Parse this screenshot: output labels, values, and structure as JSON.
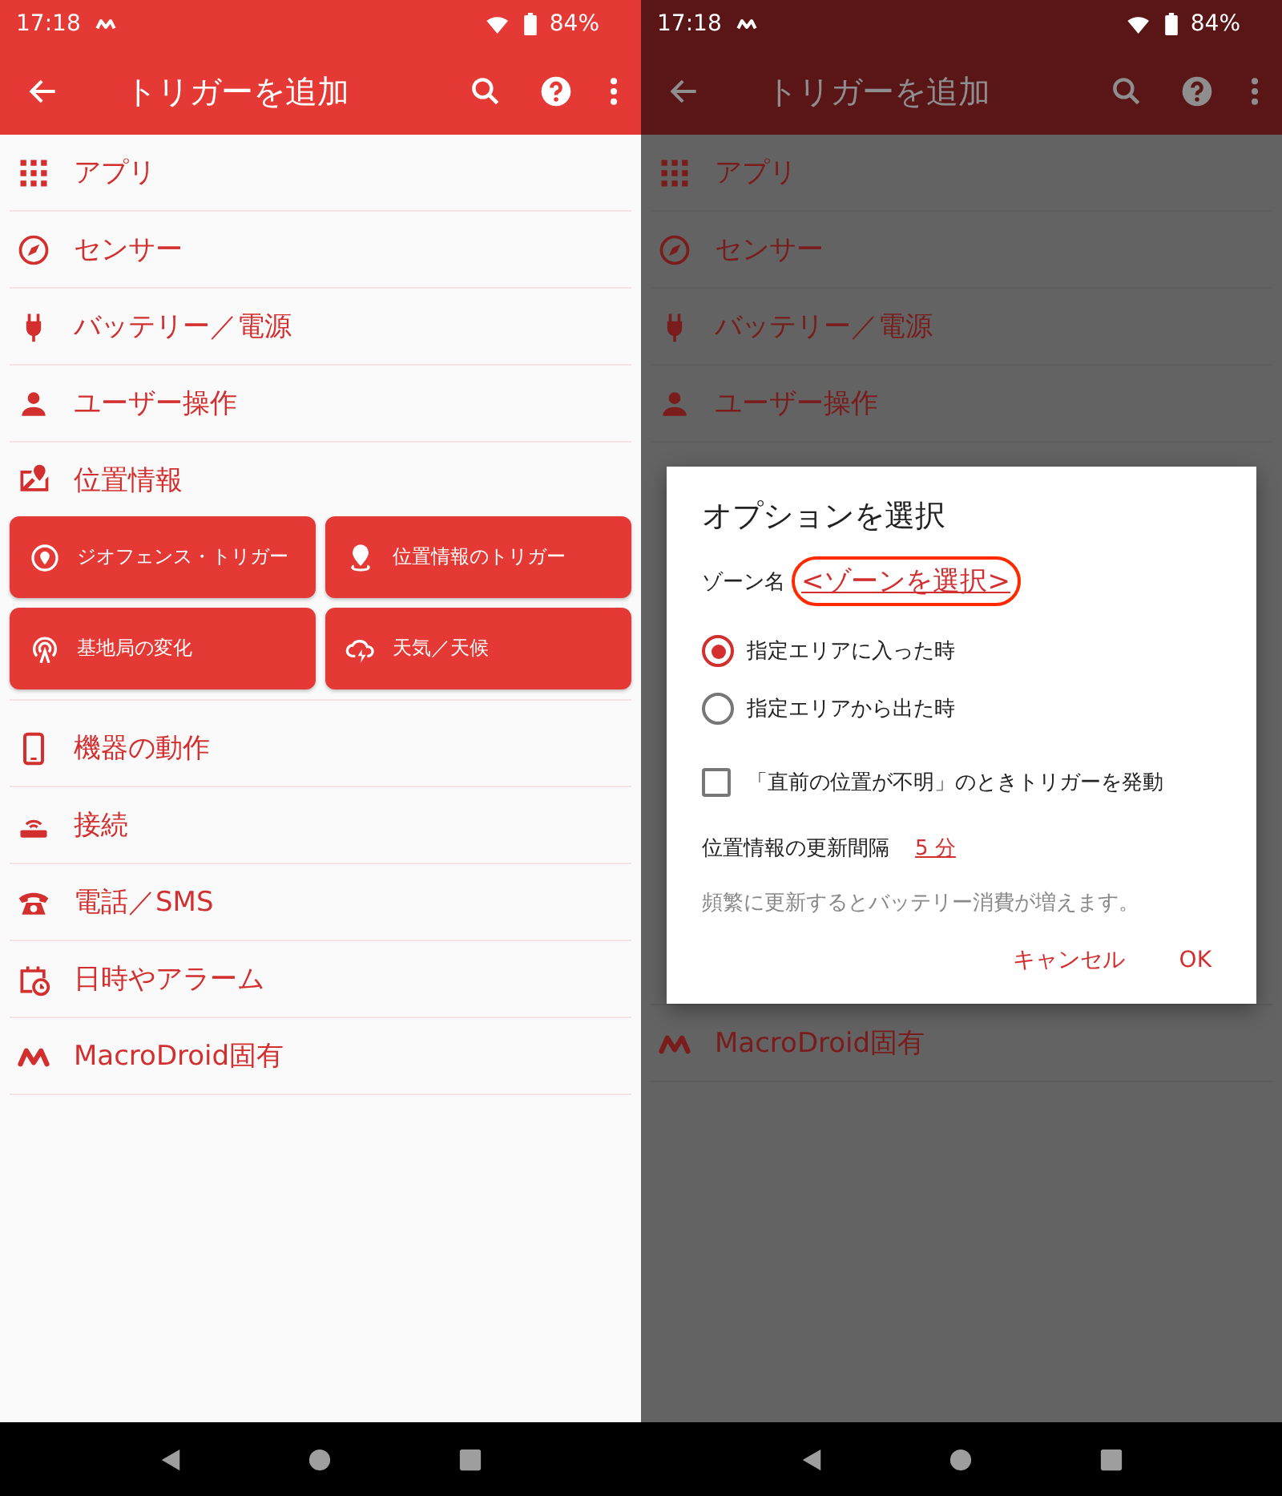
{
  "screens": [
    {
      "dimmed": false,
      "status_bar": {
        "time": "17:18",
        "battery": "84%"
      },
      "app_bar": {
        "title": "トリガーを追加"
      },
      "items": [
        {
          "label": "アプリ",
          "kind": "apps"
        },
        {
          "label": "センサー",
          "kind": "compass"
        },
        {
          "label": "バッテリー／電源",
          "kind": "plug"
        },
        {
          "label": "ユーザー操作",
          "kind": "person"
        },
        {
          "label": "位置情報",
          "kind": "map",
          "expanded": true,
          "options": [
            {
              "label": "ジオフェンス・トリガー",
              "kind": "target"
            },
            {
              "label": "位置情報のトリガー",
              "kind": "pin"
            },
            {
              "label": "基地局の変化",
              "kind": "antenna"
            },
            {
              "label": "天気／天候",
              "kind": "cloud"
            }
          ]
        },
        {
          "label": "機器の動作",
          "kind": "phone"
        },
        {
          "label": "接続",
          "kind": "router"
        },
        {
          "label": "電話／SMS",
          "kind": "telephone"
        },
        {
          "label": "日時やアラーム",
          "kind": "calendar"
        },
        {
          "label": "MacroDroid固有",
          "kind": "logo"
        }
      ]
    },
    {
      "dimmed": true,
      "status_bar": {
        "time": "17:18",
        "battery": "84%"
      },
      "app_bar": {
        "title": "トリガーを追加"
      },
      "items": [
        {
          "label": "アプリ",
          "kind": "apps"
        },
        {
          "label": "センサー",
          "kind": "compass"
        },
        {
          "label": "バッテリー／電源",
          "kind": "plug"
        },
        {
          "label": "ユーザー操作",
          "kind": "person"
        }
      ],
      "items_below": [
        {
          "label": "MacroDroid固有",
          "kind": "logo"
        }
      ],
      "dialog": {
        "title": "オプションを選択",
        "zone_label": "ゾーン名",
        "zone_link": "<ゾーンを選択>",
        "zone_highlighted": true,
        "radios": [
          {
            "label": "指定エリアに入った時",
            "selected": true
          },
          {
            "label": "指定エリアから出た時",
            "selected": false
          }
        ],
        "checkbox": {
          "label": "「直前の位置が不明」のときトリガーを発動",
          "checked": false
        },
        "interval_label": "位置情報の更新間隔",
        "interval_value": "5 分",
        "hint": "頻繁に更新するとバッテリー消費が増えます。",
        "buttons": [
          "キャンセル",
          "OK"
        ]
      }
    }
  ]
}
